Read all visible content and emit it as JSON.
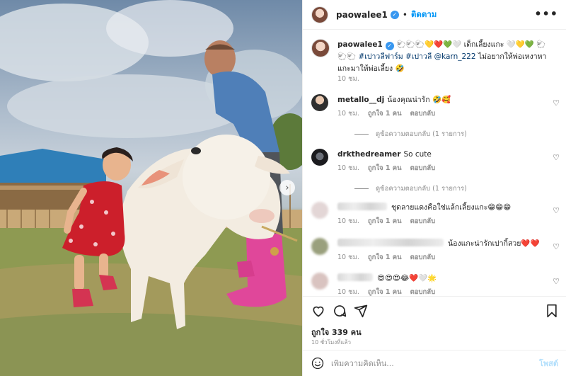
{
  "post": {
    "username": "paowalee1",
    "follow_label": "ติดตาม",
    "more_label": "•••",
    "caption_line1": "🐑🐑🐑💛❤️💚🤍 เด็กเลี้ยงแกะ 🤍💛💚",
    "caption_tags": "🐑🐑🐑 #เปาวลีฟาร์ม #เปาวลี @karn_222",
    "caption_rest": " ไม่อยากให้พ่อเหงาหาแกะมาให้พ่อเลี้ยง 🤣",
    "caption_time": "10 ชม.",
    "likes_label": "ถูกใจ 339 คน",
    "posted_ago": "10 ชั่วโมงที่แล้ว"
  },
  "comments": [
    {
      "user": "metallo__dj",
      "text": "น้องคุณน่ารัก 🤣🥰",
      "time": "10 ชม.",
      "likes": "ถูกใจ 1 คน",
      "reply": "ตอบกลับ",
      "view_replies": "ดูข้อความตอบกลับ (1 รายการ)"
    },
    {
      "user": "drkthedreamer",
      "text": "So cute",
      "time": "10 ชม.",
      "likes": "ถูกใจ 1 คน",
      "reply": "ตอบกลับ",
      "view_replies": "ดูข้อความตอบกลับ (1 รายการ)"
    },
    {
      "user": "",
      "text": "ชุดลายแดงคือใช่แล้กเลี้ยงแกะ😁😁😁",
      "time": "10 ชม.",
      "likes": "ถูกใจ 1 คน",
      "reply": "ตอบกลับ"
    },
    {
      "user": "",
      "text": "น้องแกะน่ารักเปากิ้สวย❤️❤️",
      "time": "10 ชม.",
      "likes": "ถูกใจ 1 คน",
      "reply": "ตอบกลับ"
    },
    {
      "user": "",
      "text": "😍😍😍😂❤️🤍🌟",
      "time": "10 ชม.",
      "likes": "ถูกใจ 1 คน",
      "reply": "ตอบกลับ"
    }
  ],
  "composer": {
    "placeholder": "เพิ่มความคิดเห็น...",
    "post_label": "โพสต์"
  },
  "colors": {
    "accent": "#0095f6",
    "verified": "#3897f0"
  }
}
